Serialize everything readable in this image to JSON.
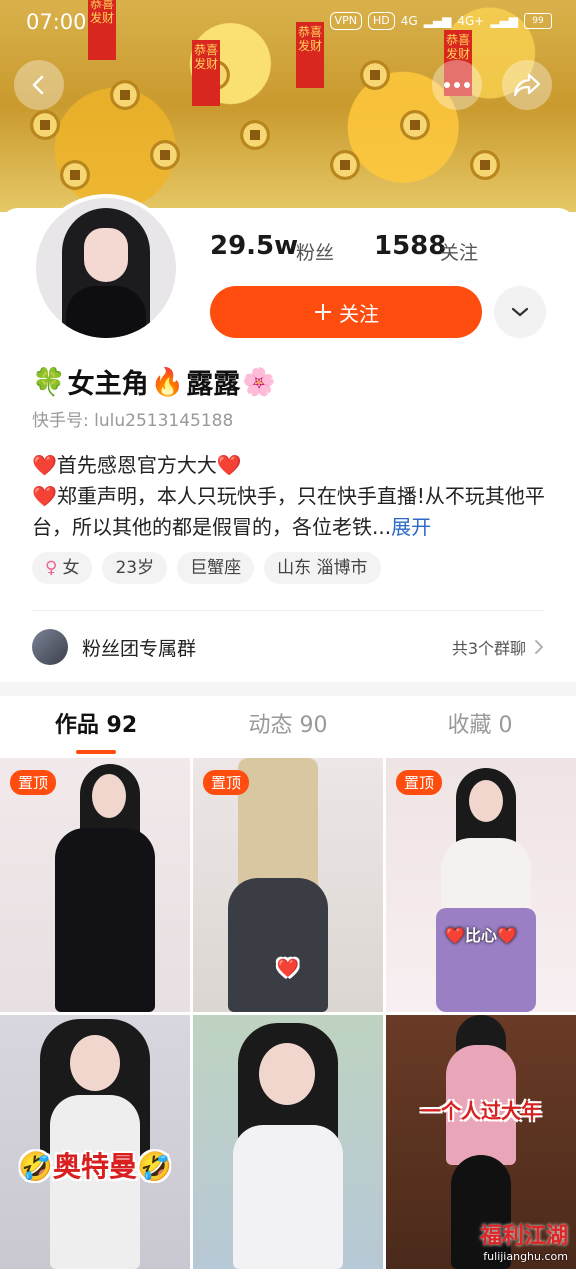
{
  "status_bar": {
    "time": "07:00",
    "badges": [
      "VPN",
      "HD",
      "4G",
      "4G+"
    ],
    "battery": "99"
  },
  "header": {
    "back_icon": "chevron-left-icon",
    "more_icon": "more-dots-icon",
    "share_icon": "share-arrow-icon",
    "banner_tags": [
      "恭喜发财",
      "恭喜发财",
      "恭喜发财",
      "恭喜发财"
    ]
  },
  "profile": {
    "fans_count": "29.5w",
    "fans_label": "粉丝",
    "following_count": "1588",
    "following_label": "关注",
    "follow_button_label": "关注",
    "name": "女主角",
    "name_suffix": "露露",
    "uid": "快手号: lulu2513145188",
    "bio_line1": "首先感恩官方大大",
    "bio_line2": "郑重声明，本人只玩快手，只在快手直播!从不玩其他平台，所以其他的都是假冒的，各位老铁...",
    "bio_expand": "展开",
    "tags": [
      "女",
      "23岁",
      "巨蟹座",
      "山东 淄博市"
    ],
    "group_title": "粉丝团专属群",
    "group_count": "共3个群聊"
  },
  "tabs": [
    {
      "label": "作品 92",
      "active": true
    },
    {
      "label": "动态 90",
      "active": false
    },
    {
      "label": "收藏 0",
      "active": false
    }
  ],
  "videos": [
    {
      "pinned": true,
      "pin_label": "置顶",
      "caption": ""
    },
    {
      "pinned": true,
      "pin_label": "置顶",
      "caption": ""
    },
    {
      "pinned": true,
      "pin_label": "置顶",
      "caption": "比心"
    },
    {
      "pinned": false,
      "pin_label": "",
      "caption": "奥特曼"
    },
    {
      "pinned": false,
      "pin_label": "",
      "caption": ""
    },
    {
      "pinned": false,
      "pin_label": "",
      "caption": "一个人过大年"
    }
  ],
  "watermark": {
    "main": "福利江湖",
    "sub": "fulijianghu.com"
  },
  "colors": {
    "accent": "#fe4d0f",
    "link": "#2b6ac8",
    "banner": "#d9b14b"
  }
}
